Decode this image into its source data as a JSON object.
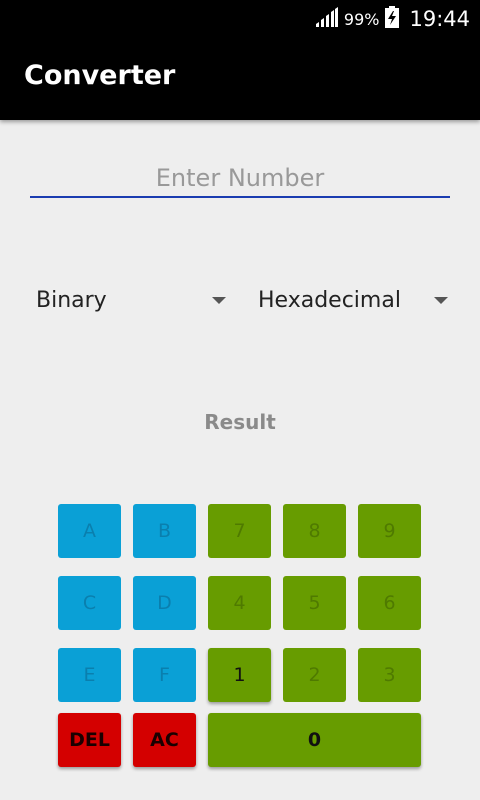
{
  "status_bar": {
    "battery": "99%",
    "time": "19:44"
  },
  "app_bar": {
    "title": "Converter"
  },
  "input": {
    "placeholder": "Enter Number",
    "value": ""
  },
  "from_spinner": {
    "selected": "Binary"
  },
  "to_spinner": {
    "selected": "Hexadecimal"
  },
  "result": {
    "label": "Result"
  },
  "keypad": {
    "a": "A",
    "b": "B",
    "c": "C",
    "d": "D",
    "e": "E",
    "f": "F",
    "k7": "7",
    "k8": "8",
    "k9": "9",
    "k4": "4",
    "k5": "5",
    "k6": "6",
    "k1": "1",
    "k2": "2",
    "k3": "3",
    "del": "DEL",
    "ac": "AC",
    "k0": "0"
  },
  "colors": {
    "hex_key": "#0aa0d6",
    "digit_key": "#679c00",
    "danger_key": "#d40000",
    "input_underline": "#1a3cb0"
  }
}
